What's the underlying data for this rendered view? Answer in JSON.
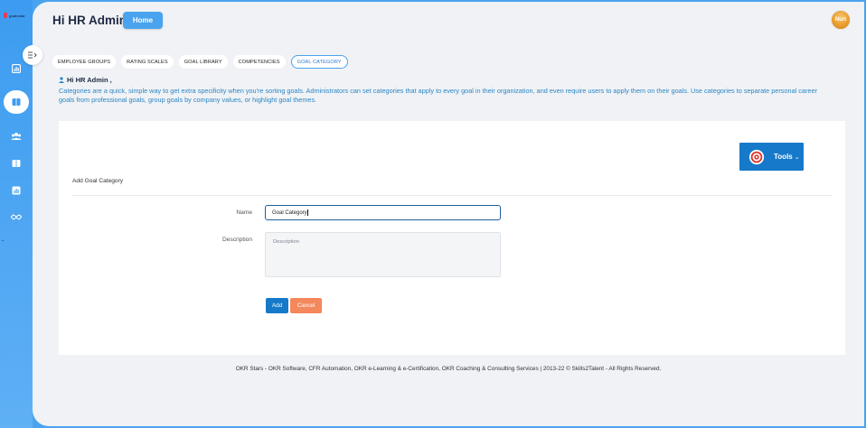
{
  "app": {
    "logo_text": "goalsstar"
  },
  "header": {
    "greeting": "Hi HR Admin",
    "home_label": "Home",
    "avatar_text": "Nurt"
  },
  "sidebar": {
    "items": [
      {
        "icon": "chart-icon"
      },
      {
        "icon": "book-icon",
        "active": true
      },
      {
        "icon": "users-icon"
      },
      {
        "icon": "book-open-icon"
      },
      {
        "icon": "bar-chart-icon"
      },
      {
        "icon": "handshake-icon"
      }
    ]
  },
  "tabs": [
    {
      "label": "EMPLOYEE GROUPS"
    },
    {
      "label": "RATING SCALES"
    },
    {
      "label": "GOAL LIBRARY"
    },
    {
      "label": "COMPETENCIES"
    },
    {
      "label": "GOAL CATEGORY",
      "active": true
    }
  ],
  "info": {
    "user_line": "Hi HR Admin ,",
    "description": "Categories are a quick, simple way to get extra specificity when you're sorting goals. Administrators can set categories that apply to every goal in their organization, and even require users to apply them on their goals. Use categories to separate personal career goals from professional goals, group goals by company values, or highlight goal themes."
  },
  "form": {
    "tools_label": "Tools",
    "section_title": "Add Goal Category",
    "name_label": "Name",
    "name_value": "Goal Category",
    "description_label": "Description",
    "description_placeholder": "Description",
    "add_label": "Add",
    "cancel_label": "Cancel"
  },
  "footer": {
    "text": "OKR Stars - OKR Software, CFR Automation, OKR e-Learning & e-Certification, OKR Coaching & Consulting Services | 2013-22 © Skills2Talent - All Rights Reserved."
  },
  "colors": {
    "sidebar": "#4aa3ef",
    "primary": "#1779c9",
    "cancel": "#f4875c",
    "info_text": "#2b86c5"
  }
}
